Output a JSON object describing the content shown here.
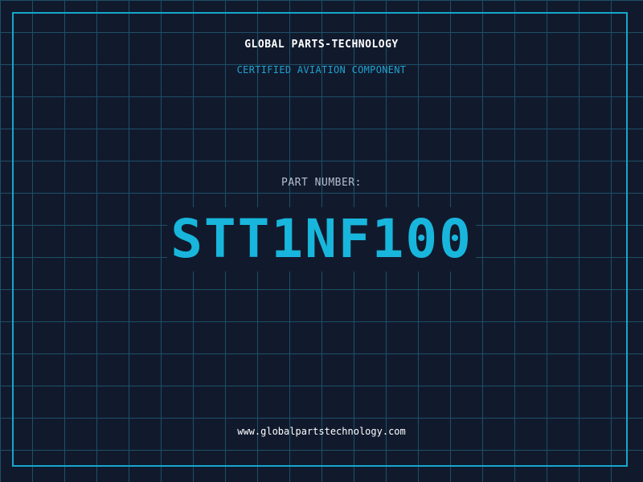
{
  "header": {
    "company": "GLOBAL PARTS-TECHNOLOGY",
    "tagline": "CERTIFIED AVIATION COMPONENT"
  },
  "part": {
    "label": "PART NUMBER:",
    "number": "STT1NF100"
  },
  "footer": {
    "url": "www.globalpartstechnology.com"
  },
  "colors": {
    "background": "#111a2d",
    "grid": "#1d4f66",
    "accent": "#18b6dc",
    "text": "#ffffff"
  }
}
